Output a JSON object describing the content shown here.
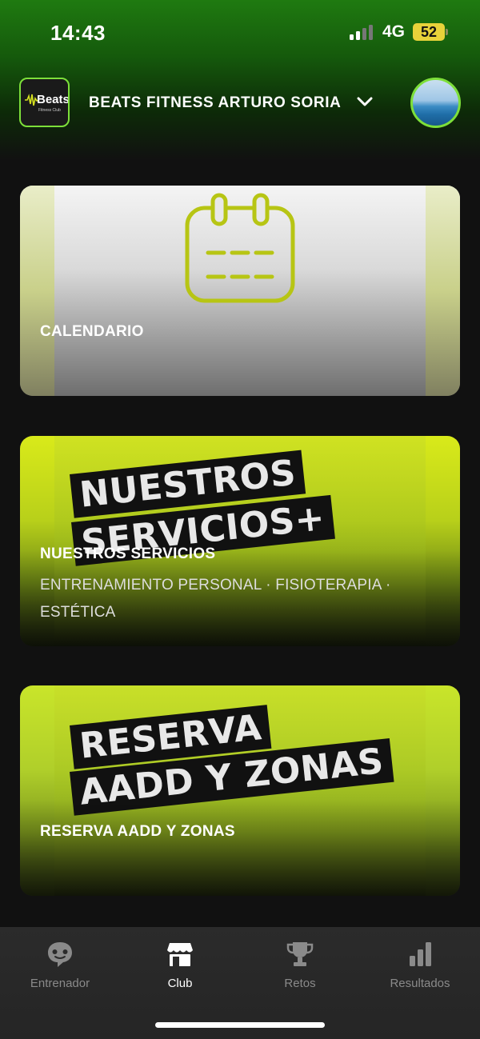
{
  "status_bar": {
    "time": "14:43",
    "network": "4G",
    "battery": "52"
  },
  "header": {
    "logo_text": "Beats",
    "logo_subtext": "Fitness Club",
    "club_name": "BEATS FITNESS ARTURO SORIA",
    "dropdown_icon": "chevron-down-icon",
    "avatar": "avatar"
  },
  "cards": [
    {
      "title": "CALENDARIO",
      "icon": "calendar-icon"
    },
    {
      "title": "NUESTROS SERVICIOS",
      "subtitle": "ENTRENAMIENTO PERSONAL · FISIOTERAPIA · ESTÉTICA",
      "banner_line1": "NUESTROS",
      "banner_line2": "SERVICIOS+"
    },
    {
      "title": "RESERVA AADD Y ZONAS",
      "banner_line1": "RESERVA",
      "banner_line2": "AADD Y ZONAS"
    }
  ],
  "tabbar": {
    "tabs": [
      {
        "label": "Entrenador",
        "icon": "chat-bubble-icon",
        "active": false
      },
      {
        "label": "Club",
        "icon": "store-icon",
        "active": true
      },
      {
        "label": "Retos",
        "icon": "trophy-icon",
        "active": false
      },
      {
        "label": "Resultados",
        "icon": "bar-chart-icon",
        "active": false
      }
    ]
  },
  "colors": {
    "accent": "#7ddf3a",
    "calendar_icon": "#b7c514",
    "header_green": "#1f7a10",
    "background": "#111111"
  }
}
